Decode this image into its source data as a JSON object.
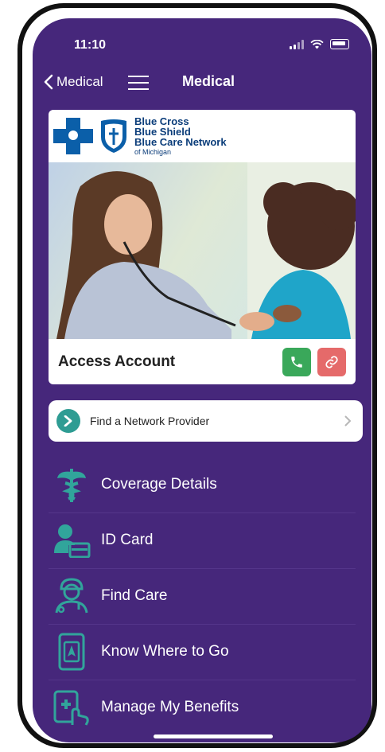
{
  "status_bar": {
    "time": "11:10"
  },
  "nav": {
    "back_label": "Medical",
    "title": "Medical"
  },
  "brand": {
    "line1": "Blue Cross",
    "line2": "Blue Shield",
    "line3": "Blue Care Network",
    "line4": "of Michigan"
  },
  "hero": {
    "access_label": "Access Account"
  },
  "provider": {
    "label": "Find a Network Provider"
  },
  "menu": [
    {
      "label": "Coverage Details",
      "icon": "caduceus-icon"
    },
    {
      "label": "ID Card",
      "icon": "id-card-icon"
    },
    {
      "label": "Find Care",
      "icon": "doctor-icon"
    },
    {
      "label": "Know Where to Go",
      "icon": "phone-map-icon"
    },
    {
      "label": "Manage My Benefits",
      "icon": "tablet-medical-icon"
    }
  ],
  "colors": {
    "background": "#46277b",
    "accent_teal": "#2e9c93",
    "call_green": "#3aa85a",
    "link_red": "#e56a6a",
    "brand_blue": "#0b5fa9"
  }
}
